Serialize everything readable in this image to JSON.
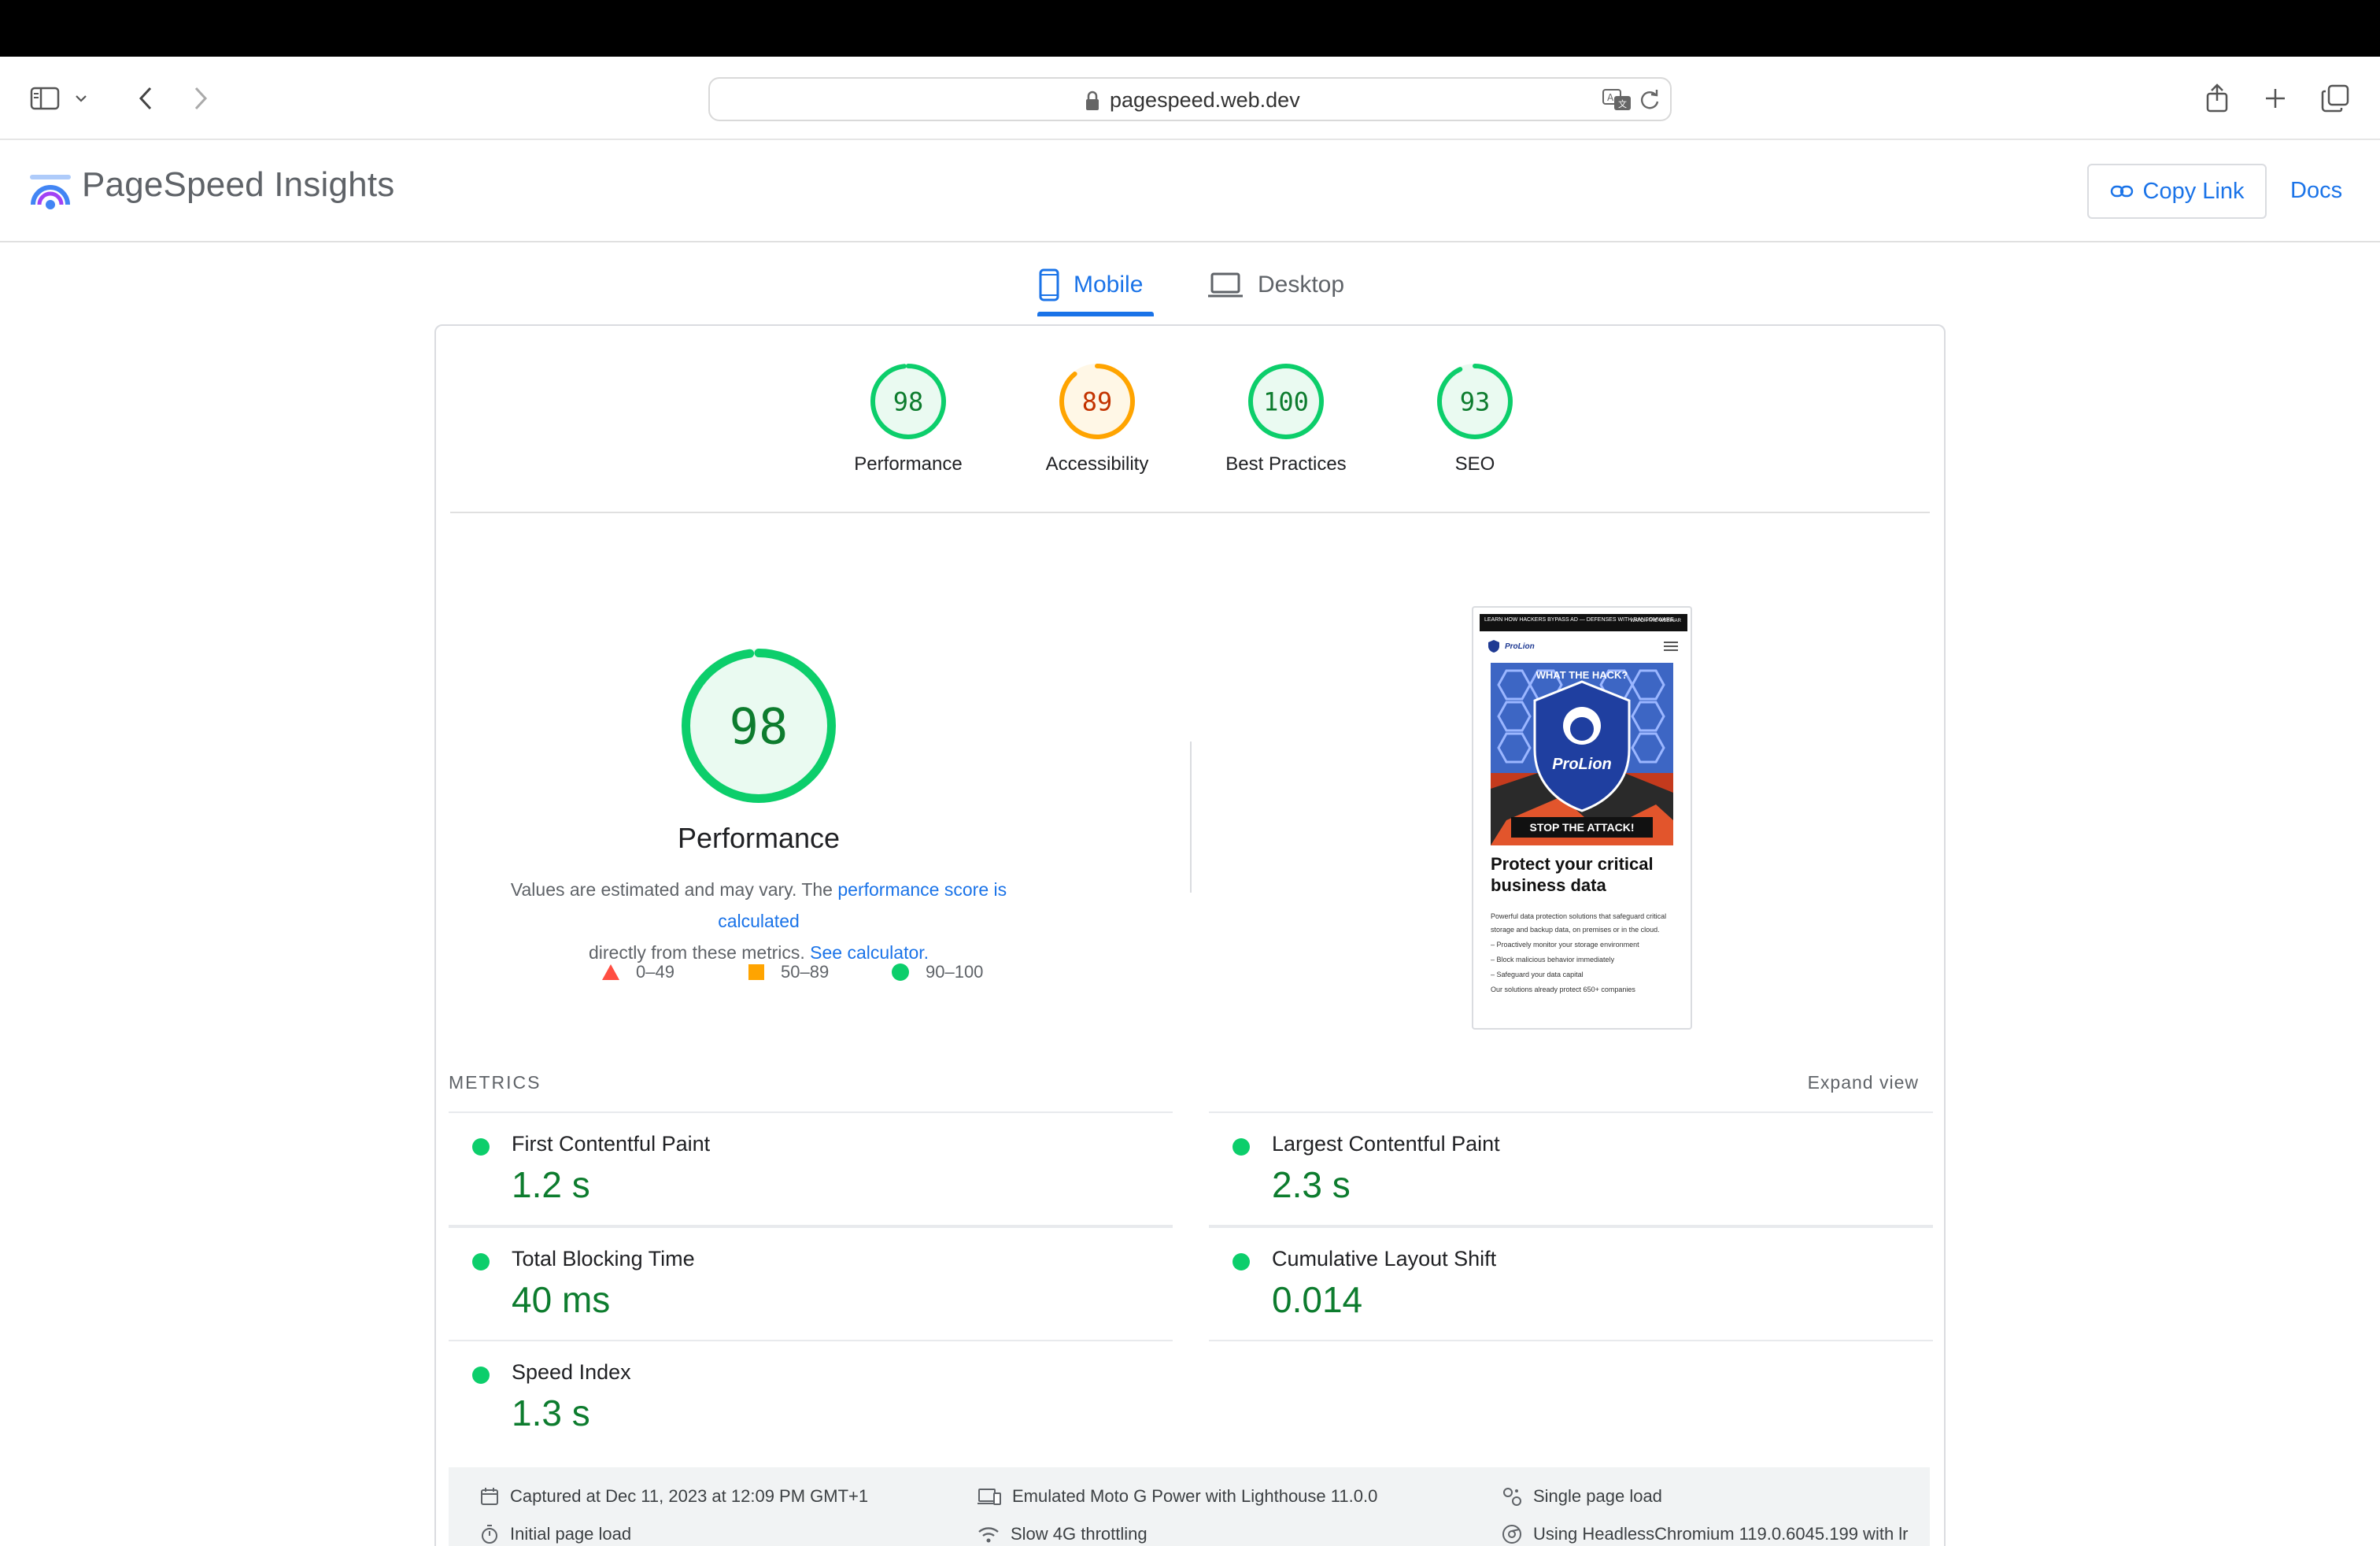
{
  "browser": {
    "url": "pagespeed.web.dev"
  },
  "header": {
    "title": "PageSpeed Insights",
    "copy_link": "Copy Link",
    "docs": "Docs"
  },
  "tabs": [
    {
      "label": "Mobile",
      "active": true
    },
    {
      "label": "Desktop",
      "active": false
    }
  ],
  "categories": [
    {
      "label": "Performance",
      "score": "98",
      "value": 98,
      "color": "#0cce6b",
      "text_color": "#0d7c2e",
      "bg": "#eafaf1"
    },
    {
      "label": "Accessibility",
      "score": "89",
      "value": 89,
      "color": "#ffa400",
      "text_color": "#c33300",
      "bg": "#fff7e6"
    },
    {
      "label": "Best Practices",
      "score": "100",
      "value": 100,
      "color": "#0cce6b",
      "text_color": "#0d7c2e",
      "bg": "#eafaf1"
    },
    {
      "label": "SEO",
      "score": "93",
      "value": 93,
      "color": "#0cce6b",
      "text_color": "#0d7c2e",
      "bg": "#eafaf1"
    }
  ],
  "performance": {
    "score": "98",
    "value": 98,
    "title": "Performance",
    "desc_prefix": "Values are estimated and may vary. The ",
    "desc_link1": "performance score is calculated",
    "desc_middle": "directly from these metrics. ",
    "desc_link2": "See calculator."
  },
  "legend": [
    {
      "range": "0–49",
      "shape": "triangle",
      "color": "#ff4e42"
    },
    {
      "range": "50–89",
      "shape": "square",
      "color": "#ffa400"
    },
    {
      "range": "90–100",
      "shape": "circle",
      "color": "#0cce6b"
    }
  ],
  "screenshot": {
    "banner_left": "LEARN HOW HACKERS BYPASS AD — DEFENSES WITH RANSOMWARE",
    "banner_right": "WATCH THE WEBINAR",
    "brand": "ProLion",
    "hero_top": "WHAT THE HACK?",
    "hero_brand": "ProLion",
    "hero_bottom": "STOP THE ATTACK!",
    "heading": "Protect your critical business data",
    "para": "Powerful data protection solutions that safeguard critical storage and backup data, on premises or in the cloud.",
    "bullet1": "– Proactively monitor your storage environment",
    "bullet2": "– Block malicious behavior immediately",
    "bullet3": "– Safeguard your data capital",
    "footer": "Our solutions already protect 650+ companies"
  },
  "metrics": {
    "section_label": "METRICS",
    "expand": "Expand view",
    "items": [
      {
        "name": "First Contentful Paint",
        "value": "1.2 s"
      },
      {
        "name": "Largest Contentful Paint",
        "value": "2.3 s"
      },
      {
        "name": "Total Blocking Time",
        "value": "40 ms"
      },
      {
        "name": "Cumulative Layout Shift",
        "value": "0.014"
      },
      {
        "name": "Speed Index",
        "value": "1.3 s"
      }
    ]
  },
  "environment": [
    {
      "text": "Captured at Dec 11, 2023 at 12:09 PM GMT+1",
      "icon": "calendar-icon"
    },
    {
      "text": "Emulated Moto G Power with Lighthouse 11.0.0",
      "icon": "device-icon"
    },
    {
      "text": "Single page load",
      "icon": "single-load-icon"
    },
    {
      "text": "Initial page load",
      "icon": "timer-icon"
    },
    {
      "text": "Slow 4G throttling",
      "icon": "wifi-icon"
    },
    {
      "text": "Using HeadlessChromium 119.0.6045.199 with lr",
      "icon": "chromium-icon"
    }
  ]
}
